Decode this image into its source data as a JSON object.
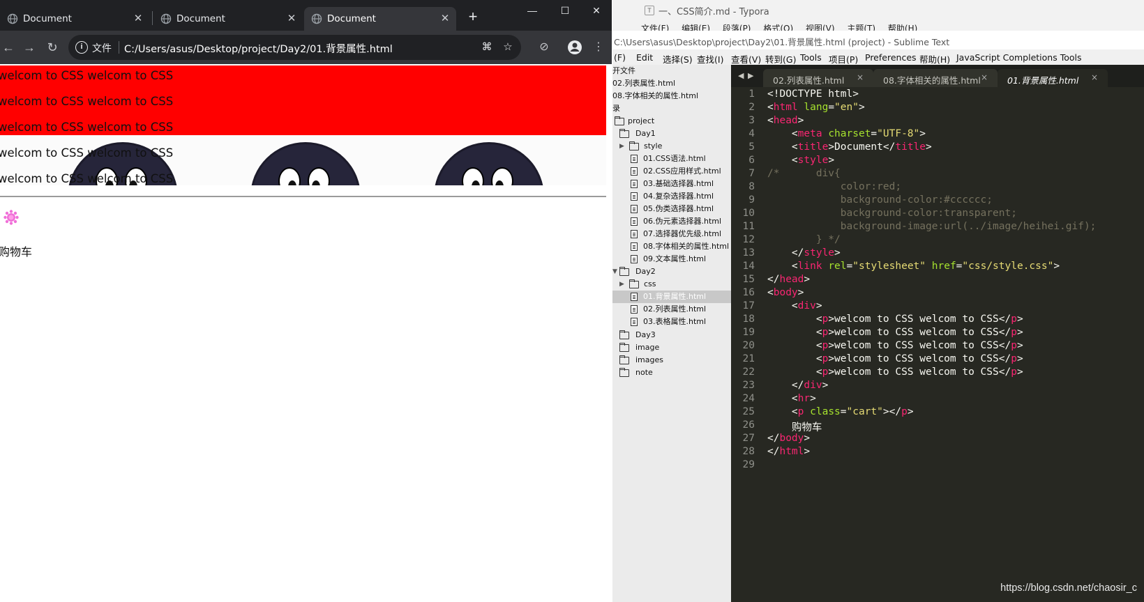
{
  "chrome": {
    "tabs": [
      {
        "title": "Document"
      },
      {
        "title": "Document"
      },
      {
        "title": "Document"
      }
    ],
    "new_tab": "+",
    "window_controls": {
      "minimize": "—",
      "maximize": "☐",
      "close": "✕"
    },
    "address": {
      "protocol": "文件",
      "url": "C:/Users/asus/Desktop/project/Day2/01.背景属性.html"
    }
  },
  "page": {
    "lines": [
      "welcom to CSS welcom to CSS",
      "welcom to CSS welcom to CSS",
      "welcom to CSS welcom to CSS",
      "welcom to CSS welcom to CSS",
      "welcom to CSS welcom to CSS"
    ],
    "cart": "购物车"
  },
  "typora": {
    "title": "一、CSS简介.md - Typora",
    "menu": [
      "文件(F)",
      "编辑(E)",
      "段落(P)",
      "格式(O)",
      "视图(V)",
      "主题(T)",
      "帮助(H)"
    ]
  },
  "sublime": {
    "title": "C:\\Users\\asus\\Desktop\\project\\Day2\\01.背景属性.html (project) - Sublime Text",
    "menu": [
      "(F)",
      "Edit",
      "选择(S)",
      "查找(I)",
      "查看(V)",
      "转到(G)",
      "Tools",
      "项目(P)",
      "Preferences",
      "帮助(H)",
      "JavaScript Completions Tools"
    ],
    "sidebar": {
      "open_files_header": "开文件",
      "open_files": [
        "02.列表属性.html",
        "08.字体相关的属性.html"
      ],
      "folders_header": "录",
      "project": "project",
      "day1": "Day1",
      "day1_style": "style",
      "day1_files": [
        "01.CSS语法.html",
        "02.CSS应用样式.html",
        "03.基础选择器.html",
        "04.复杂选择器.html",
        "05.伪类选择器.html",
        "06.伪元素选择器.html",
        "07.选择器优先级.html",
        "08.字体相关的属性.html",
        "09.文本属性.html"
      ],
      "day2": "Day2",
      "day2_css": "css",
      "day2_files": [
        "01.背景属性.html",
        "02.列表属性.html",
        "03.表格属性.html"
      ],
      "others": [
        "Day3",
        "image",
        "images",
        "note"
      ]
    },
    "tabs": [
      "02.列表属性.html",
      "08.字体相关的属性.html",
      "01.背景属性.html"
    ],
    "line_numbers": [
      "1",
      "2",
      "3",
      "4",
      "5",
      "6",
      "7",
      "8",
      "9",
      "10",
      "11",
      "12",
      "13",
      "14",
      "15",
      "16",
      "17",
      "18",
      "19",
      "20",
      "21",
      "22",
      "23",
      "24",
      "25",
      "26",
      "27",
      "28",
      "29"
    ],
    "code": {
      "l1": "<!DOCTYPE html>",
      "html_tag": "html",
      "lang_attr": "lang",
      "lang_val": "\"en\"",
      "head": "head",
      "meta": "meta",
      "charset": "charset",
      "charset_val": "\"UTF-8\"",
      "title": "title",
      "title_text": "Document",
      "style": "style",
      "c7": "/*      div{",
      "c8": "            color:red;",
      "c9": "            background-color:#cccccc;",
      "c10": "            background-color:transparent;",
      "c11": "            background-image:url(../image/heihei.gif);",
      "c12": "        } */",
      "link": "link",
      "rel": "rel",
      "rel_val": "\"stylesheet\"",
      "href": "href",
      "href_val": "\"css/style.css\"",
      "body": "body",
      "div": "div",
      "p": "p",
      "p_text": "welcom to CSS welcom to CSS",
      "hr": "hr",
      "class_attr": "class",
      "class_val": "\"cart\"",
      "cart_text": "购物车"
    }
  },
  "watermark": "https://blog.csdn.net/chaosir_c",
  "colors": {
    "page_red": "#ff0000",
    "editor_bg": "#272822",
    "chrome_dark": "#202124"
  }
}
